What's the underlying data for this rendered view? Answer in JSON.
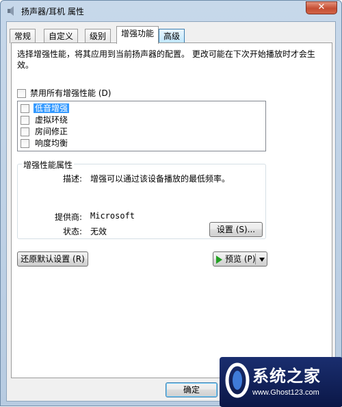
{
  "window": {
    "title": "扬声器/耳机 属性",
    "close_label": "✕"
  },
  "tabs": [
    {
      "label": "常规"
    },
    {
      "label": "自定义"
    },
    {
      "label": "级别"
    },
    {
      "label": "增强功能"
    },
    {
      "label": "高级"
    }
  ],
  "enhancements": {
    "description": "选择增强性能，将其应用到当前扬声器的配置。  更改可能在下次开始播放时才会生效。",
    "disable_all_label": "禁用所有增强性能 (D)",
    "items": [
      {
        "label": "低音增强",
        "checked": false,
        "selected": true
      },
      {
        "label": "虚拟环绕",
        "checked": false,
        "selected": false
      },
      {
        "label": "房间修正",
        "checked": false,
        "selected": false
      },
      {
        "label": "响度均衡",
        "checked": false,
        "selected": false
      }
    ]
  },
  "properties": {
    "group_title": "增强性能属性",
    "description_label": "描述:",
    "description_value": "增强可以通过该设备播放的最低频率。",
    "provider_label": "提供商:",
    "provider_value": "Microsoft",
    "status_label": "状态:",
    "status_value": "无效",
    "settings_button": "设置 (S)..."
  },
  "buttons": {
    "restore_defaults": "还原默认设置 (R)",
    "preview": "预览 (P)",
    "ok": "确定"
  },
  "watermark": {
    "title": "系统之家",
    "url": "www.Ghost123.com"
  },
  "colors": {
    "selection": "#3399ff",
    "close_button": "#c54e33",
    "preview_icon": "#23a023"
  }
}
